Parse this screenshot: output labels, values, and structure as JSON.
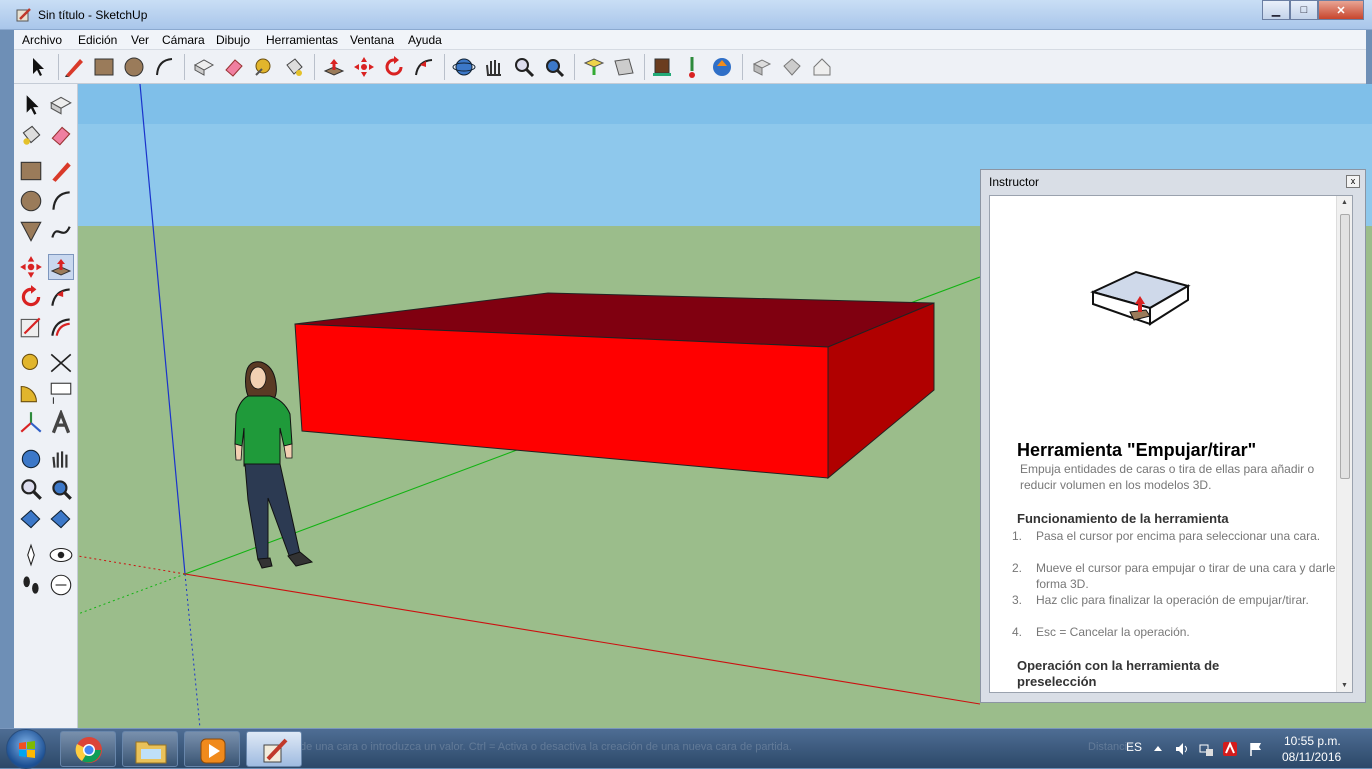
{
  "window": {
    "title": "Sin título - SketchUp",
    "controls": {
      "minimize": "▁",
      "maximize": "□",
      "close": "✕"
    }
  },
  "menu": [
    "Archivo",
    "Edición",
    "Ver",
    "Cámara",
    "Dibujo",
    "Herramientas",
    "Ventana",
    "Ayuda"
  ],
  "toolbar_icons": [
    "select-icon",
    "pencil-icon",
    "rectangle-icon",
    "circle-icon",
    "arc-icon",
    "make-component-icon",
    "eraser-icon",
    "tape-measure-icon",
    "paint-bucket-icon",
    "push-pull-icon",
    "move-icon",
    "rotate-icon",
    "follow-me-icon",
    "orbit-icon",
    "pan-icon",
    "zoom-icon",
    "zoom-extents-icon",
    "add-location-icon",
    "toggle-terrain-icon",
    "photo-textures-icon",
    "warehouse-icon",
    "share-model-icon",
    "extension-icon",
    "components-icon",
    "styles-icon",
    "layers-icon"
  ],
  "instructor": {
    "title": "Instructor",
    "close": "x",
    "heading": "Herramienta \"Empujar/tirar\"",
    "description": "Empuja entidades de caras o tira de ellas para añadir o reducir volumen en los modelos 3D.",
    "section1_title": "Funcionamiento de la herramienta",
    "steps": [
      {
        "num": "1.",
        "text": "Pasa el cursor por encima para seleccionar una cara."
      },
      {
        "num": "2.",
        "text": "Mueve el cursor para empujar o tirar de una cara y darle forma 3D."
      },
      {
        "num": "3.",
        "text": "Haz clic para finalizar la operación de empujar/tirar."
      },
      {
        "num": "4.",
        "text": "Esc = Cancelar la operación."
      }
    ],
    "section2_title": "Operación con la herramienta de preselección"
  },
  "taskbar": {
    "language": "ES",
    "time": "10:55 p.m.",
    "date": "08/11/2016",
    "status_hint": "de una cara o introduzca un valor. Ctrl = Activa o desactiva la creación de una nueva cara de partida.",
    "measure_hint": "Distancia"
  },
  "colors": {
    "sky": "#7fbfe9",
    "ground": "#9bbd8b",
    "box_front": "#ff0000",
    "box_top": "#800010",
    "box_side": "#b00000",
    "shirt": "#1f9a3a"
  }
}
